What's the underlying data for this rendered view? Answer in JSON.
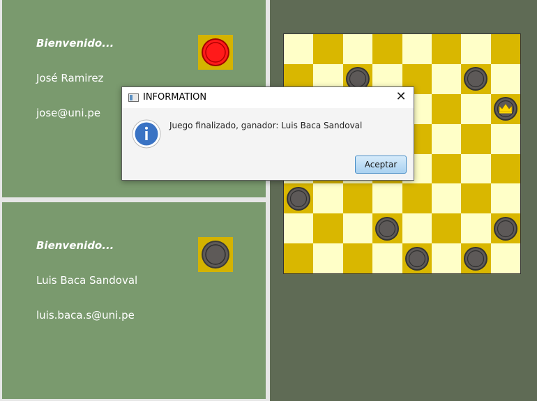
{
  "player1": {
    "welcome": "Bienvenido...",
    "name": "José Ramirez",
    "email": "jose@uni.pe",
    "piece_color": "red"
  },
  "player2": {
    "welcome": "Bienvenido...",
    "name": "Luis Baca Sandoval",
    "email": "luis.baca.s@uni.pe",
    "piece_color": "gray"
  },
  "board": {
    "rows": 8,
    "cols": 8,
    "dark_color": "#d9b700",
    "light_color": "#ffffc8",
    "pieces": [
      {
        "row": 1,
        "col": 2,
        "color": "gray",
        "king": false
      },
      {
        "row": 1,
        "col": 6,
        "color": "gray",
        "king": false
      },
      {
        "row": 2,
        "col": 7,
        "color": "gray",
        "king": true
      },
      {
        "row": 4,
        "col": 3,
        "color": "gray",
        "king": false
      },
      {
        "row": 5,
        "col": 0,
        "color": "gray",
        "king": false
      },
      {
        "row": 6,
        "col": 3,
        "color": "gray",
        "king": false
      },
      {
        "row": 6,
        "col": 7,
        "color": "gray",
        "king": false
      },
      {
        "row": 7,
        "col": 4,
        "color": "gray",
        "king": false
      },
      {
        "row": 7,
        "col": 6,
        "color": "gray",
        "king": false
      }
    ]
  },
  "dialog": {
    "title": "INFORMATION",
    "close_label": "✕",
    "icon": "info-icon",
    "message": "Juego finalizado, ganador: Luis Baca Sandoval",
    "ok_label": "Aceptar"
  }
}
